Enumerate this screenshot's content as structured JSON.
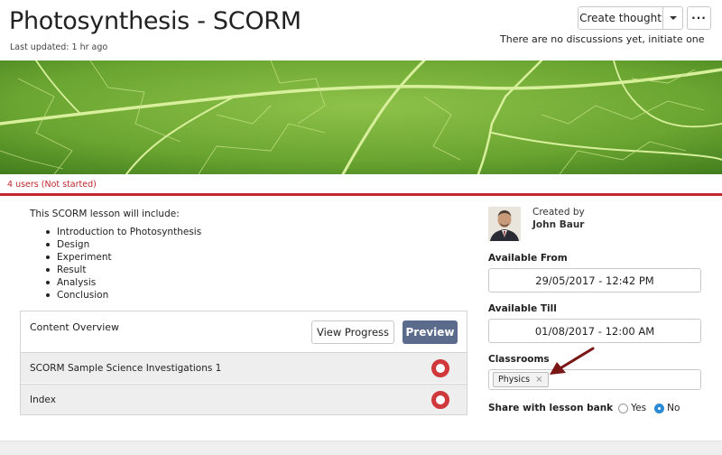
{
  "header": {
    "title": "Photosynthesis - SCORM",
    "last_updated": "Last updated: 1 hr ago",
    "create_thought_label": "Create thought",
    "more_label": "···",
    "discussion_note": "There are no discussions yet, initiate one"
  },
  "status": {
    "users_text": "4 users (Not started)",
    "accent_color": "#c0262d"
  },
  "lesson": {
    "intro": "This SCORM lesson will include:",
    "items": [
      "Introduction to Photosynthesis",
      "Design",
      "Experiment",
      "Result",
      "Analysis",
      "Conclusion"
    ]
  },
  "content_overview": {
    "title": "Content Overview",
    "view_progress_label": "View Progress",
    "preview_label": "Preview",
    "rows": [
      {
        "label": "SCORM Sample Science Investigations 1"
      },
      {
        "label": "Index"
      }
    ]
  },
  "sidebar": {
    "created_by_label": "Created by",
    "creator_name": "John Baur",
    "available_from_label": "Available From",
    "available_from_value": "29/05/2017 - 12:42 PM",
    "available_till_label": "Available Till",
    "available_till_value": "01/08/2017 - 12:00 AM",
    "classrooms_label": "Classrooms",
    "classroom_tag": "Physics",
    "tag_remove": "×",
    "share_label": "Share with lesson bank",
    "share_yes": "Yes",
    "share_no": "No",
    "share_selected": "No"
  }
}
